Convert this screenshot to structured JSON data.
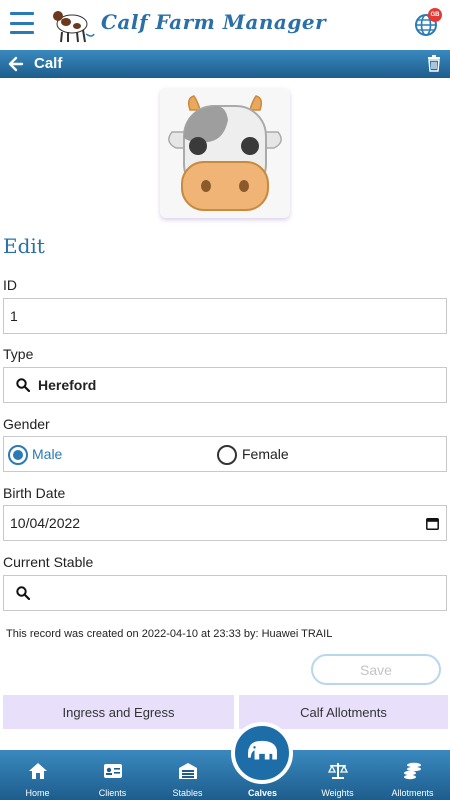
{
  "app": {
    "title": "Calf Farm Manager",
    "lang_badge": "GB"
  },
  "header": {
    "title": "Calf"
  },
  "form": {
    "heading": "Edit",
    "id_label": "ID",
    "id_value": "1",
    "type_label": "Type",
    "type_value": "Hereford",
    "gender_label": "Gender",
    "gender_options": [
      "Male",
      "Female"
    ],
    "gender_selected": "Male",
    "birth_label": "Birth Date",
    "birth_value": "10/04/2022",
    "stable_label": "Current Stable",
    "stable_value": ""
  },
  "record_note": "This record was created on 2022-04-10 at 23:33 by: Huawei TRAIL",
  "actions": {
    "save": "Save",
    "tab1": "Ingress and Egress",
    "tab2": "Calf Allotments"
  },
  "nav": {
    "home": "Home",
    "clients": "Clients",
    "stables": "Stables",
    "calves": "Calves",
    "weights": "Weights",
    "allotments": "Allotments"
  },
  "colors": {
    "primary": "#2a7ab8",
    "header_dark": "#1d5d8c",
    "tab_bg": "#e8e0fb",
    "badge": "#e53935"
  },
  "icons": [
    "menu-icon",
    "globe-icon",
    "back-arrow-icon",
    "trash-icon",
    "search-icon",
    "calendar-icon",
    "home-icon",
    "id-card-icon",
    "warehouse-icon",
    "elephant-icon",
    "scale-icon",
    "coins-icon"
  ]
}
